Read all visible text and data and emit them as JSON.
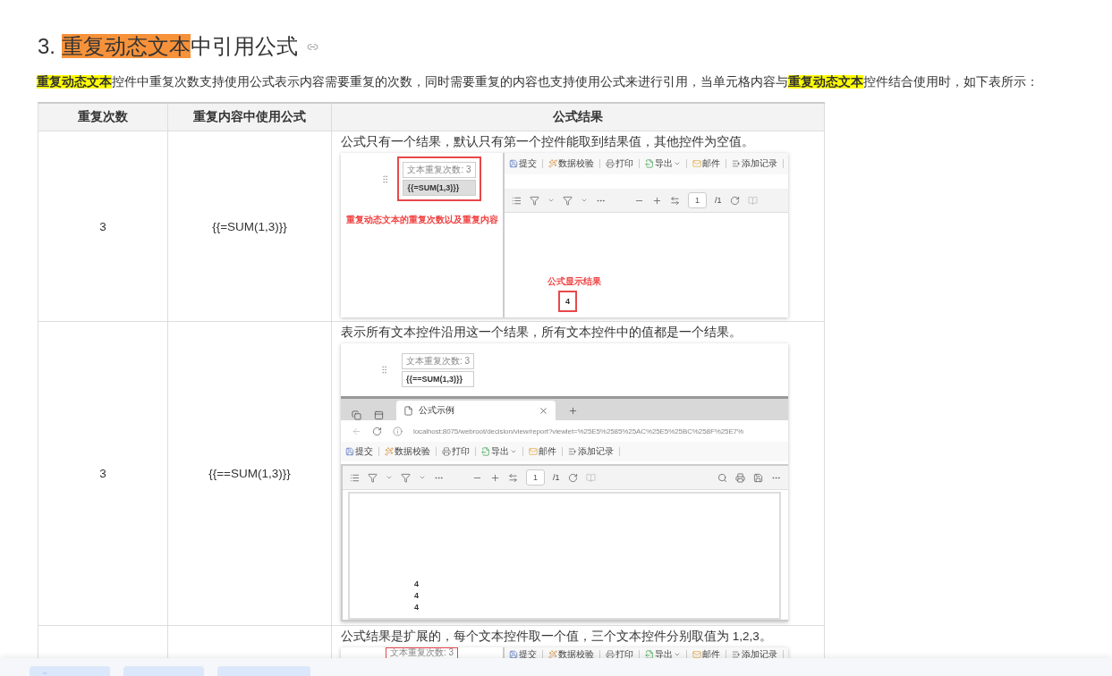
{
  "heading": {
    "number": "3.",
    "segments": [
      {
        "text": "重复动态文本",
        "highlighted": true
      },
      {
        "text": "中引用公式",
        "highlighted": false
      }
    ]
  },
  "intro": [
    {
      "text": "重复动态文本",
      "highlighted": true
    },
    {
      "text": "控件中重复次数支持使用公式表示内容需要重复的次数，同时需要重复的内容也支持使用公式来进行引用，当单元格内容与",
      "highlighted": false
    },
    {
      "text": "重复动态文本",
      "highlighted": true
    },
    {
      "text": "控件结合使用时，如下表所示：",
      "highlighted": false
    }
  ],
  "table": {
    "columns": [
      "重复次数",
      "重复内容中使用公式",
      "公式结果"
    ],
    "rows": [
      {
        "count": "3",
        "formula": "{{=SUM(1,3)}}",
        "description": "公式只有一个结果，默认只有第一个控件能取到结果值，其他控件为空值。",
        "screenshot": {
          "kind": "split",
          "outlined": true,
          "field_label": "文本重复次数: 3",
          "field_value": "{{=SUM(1,3)}}",
          "note": "重复动态文本的重复次数以及重复内容",
          "toolbar": [
            "提交",
            "数据校验",
            "打印",
            "导出",
            "邮件",
            "添加记录"
          ],
          "page_input": "1",
          "page_total": "/1",
          "result_note": "公式显示结果",
          "results": [
            "4"
          ]
        }
      },
      {
        "count": "3",
        "formula": "{{==SUM(1,3)}}",
        "description": "表示所有文本控件沿用这一个结果，所有文本控件中的值都是一个结果。",
        "screenshot": {
          "kind": "browser",
          "outlined": false,
          "field_label": "文本重复次数: 3",
          "field_value": "{{==SUM(1,3)}}",
          "tab_title": "公式示例",
          "url": "localhost:8075/webroot/decision/view/report?viewlet=%25E5%2585%25AC%25E5%25BC%258F%25E7%",
          "toolbar": [
            "提交",
            "数据校验",
            "打印",
            "导出",
            "邮件",
            "添加记录"
          ],
          "page_input": "1",
          "page_total": "/1",
          "results": [
            "4",
            "4",
            "4"
          ]
        }
      },
      {
        "description": "公式结果是扩展的，每个文本控件取一个值，三个文本控件分别取值为 1,2,3。",
        "screenshot": {
          "kind": "strip",
          "outlined": true,
          "field_label": "文本重复次数: 3",
          "toolbar": [
            "提交",
            "数据校验",
            "打印",
            "导出",
            "邮件",
            "添加记录"
          ]
        }
      }
    ]
  },
  "bottom_bar": {
    "buttons": [
      {
        "has_icon": true
      },
      {
        "has_icon": false
      },
      {
        "has_icon": false
      }
    ]
  }
}
